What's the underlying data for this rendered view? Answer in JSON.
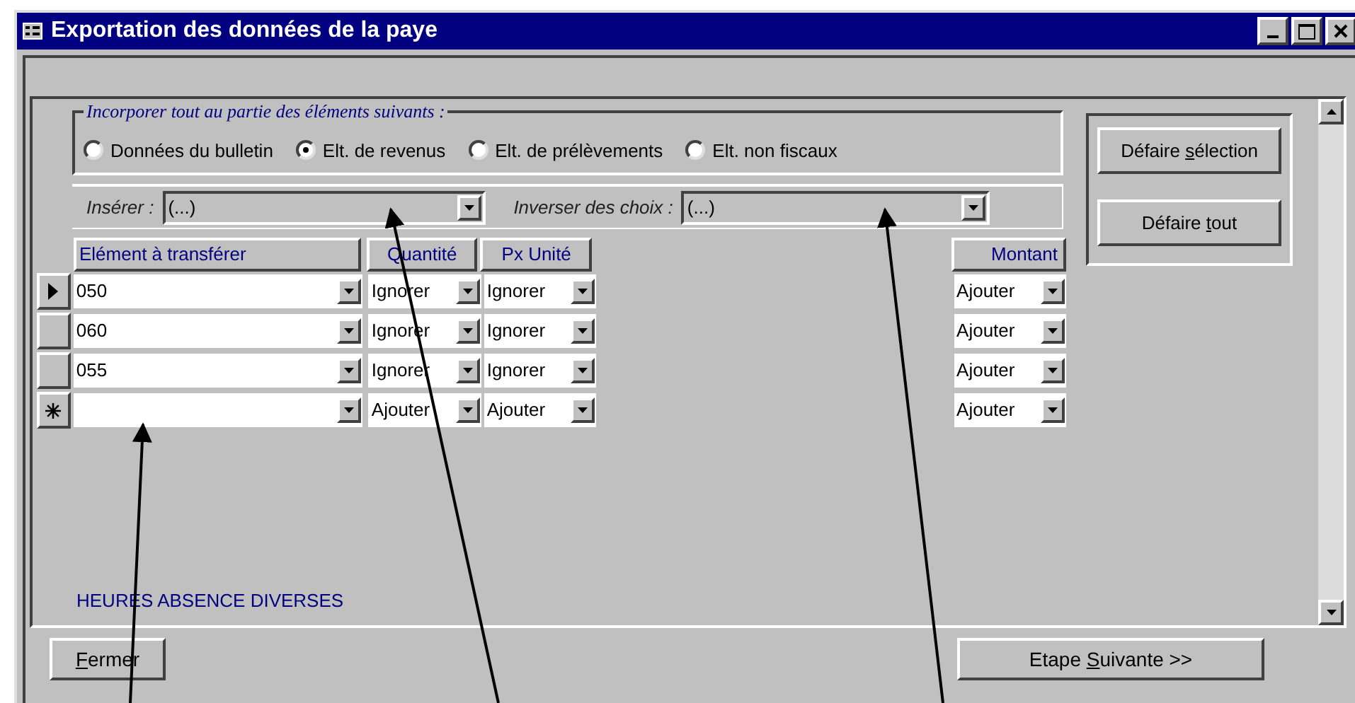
{
  "window": {
    "title": "Exportation des données de la paye"
  },
  "selection_group": {
    "legend": "Incorporer tout au partie des éléments suivants :",
    "options": [
      {
        "label": "Données du bulletin",
        "selected": false
      },
      {
        "label": "Elt. de revenus",
        "selected": true
      },
      {
        "label": "Elt. de prélèvements",
        "selected": false
      },
      {
        "label": "Elt. non fiscaux",
        "selected": false
      }
    ]
  },
  "filters": {
    "insert_label": "Insérer :",
    "insert_value": "(...)",
    "invert_label": "Inverser des choix :",
    "invert_value": "(...)"
  },
  "side_buttons": [
    {
      "before": "Défaire ",
      "key": "s",
      "after": "élection"
    },
    {
      "before": "Défaire ",
      "key": "t",
      "after": "out"
    }
  ],
  "table": {
    "columns": [
      "Elément à transférer",
      "Quantité",
      "Px Unité",
      "Montant"
    ],
    "rows": [
      {
        "kind": "current",
        "element": "050",
        "quantite": "Ignorer",
        "px_unite": "Ignorer",
        "montant": "Ajouter"
      },
      {
        "kind": "record",
        "element": "060",
        "quantite": "Ignorer",
        "px_unite": "Ignorer",
        "montant": "Ajouter"
      },
      {
        "kind": "record",
        "element": "055",
        "quantite": "Ignorer",
        "px_unite": "Ignorer",
        "montant": "Ajouter"
      },
      {
        "kind": "new",
        "quantite": "Ajouter",
        "px_unite": "Ajouter",
        "montant": "Ajouter"
      }
    ]
  },
  "footer_label": "HEURES ABSENCE DIVERSES",
  "buttons": [
    {
      "key": "F",
      "after": "ermer"
    },
    {
      "before": "Etape ",
      "key": "S",
      "after": "uivante >>"
    }
  ]
}
